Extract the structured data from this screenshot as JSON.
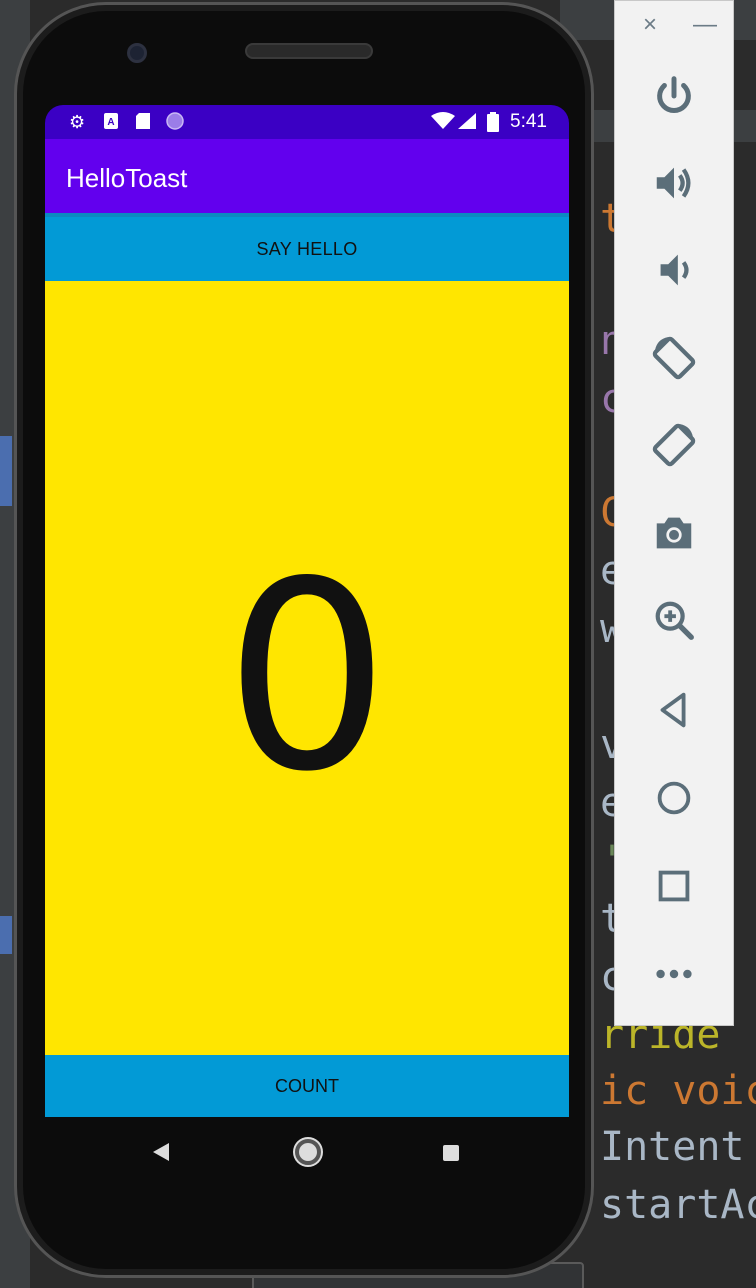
{
  "ide": {
    "code_lines": [
      {
        "text": "te",
        "color": "#cc7832"
      },
      {
        "text": "nu",
        "color": "#9876aa"
      },
      {
        "text": "ck",
        "color": "#9876aa"
      },
      {
        "text": "Cr",
        "color": "#cc7832"
      },
      {
        "text": "e(",
        "color": "#a9b7c6"
      },
      {
        "text": "w(",
        "color": "#a9b7c6"
      },
      {
        "text": " =",
        "color": "#a9b7c6"
      },
      {
        "text": "vE",
        "color": "#a9b7c6"
      },
      {
        "text": "ew",
        "color": "#a9b7c6"
      },
      {
        "text": "'H",
        "color": "#6a8759"
      },
      {
        "text": "tr",
        "color": "#a9b7c6"
      },
      {
        "text": "ck",
        "color": "#a9b7c6"
      },
      {
        "text": "rride",
        "color": "#bbb529"
      },
      {
        "text": "ic voic",
        "color": "#cc7832"
      },
      {
        "text": "Intent",
        "color": "#a9b7c6"
      },
      {
        "text": "startAc",
        "color": "#a9b7c6"
      }
    ]
  },
  "status_bar": {
    "time": "5:41",
    "left_icons": [
      "gear-icon",
      "a-icon",
      "sd-card-icon",
      "circle-icon"
    ],
    "right_icons": [
      "wifi-icon",
      "signal-icon",
      "battery-icon"
    ],
    "color": "#3b00c4"
  },
  "app": {
    "title": "HelloToast",
    "say_hello_label": "SAY HELLO",
    "count_value": "0",
    "count_label": "COUNT",
    "appbar_color": "#6200ee",
    "button_color": "#029ad6",
    "count_bg": "#ffe600"
  },
  "navigation": {
    "buttons": [
      "back-icon",
      "home-icon",
      "recents-icon"
    ]
  },
  "emulator_toolbar": {
    "close_label": "×",
    "minimize_label": "—",
    "buttons": [
      "power-icon",
      "volume-up-icon",
      "volume-down-icon",
      "rotate-left-icon",
      "rotate-right-icon",
      "camera-icon",
      "zoom-icon",
      "back-icon",
      "home-icon",
      "overview-icon",
      "more-icon"
    ]
  }
}
